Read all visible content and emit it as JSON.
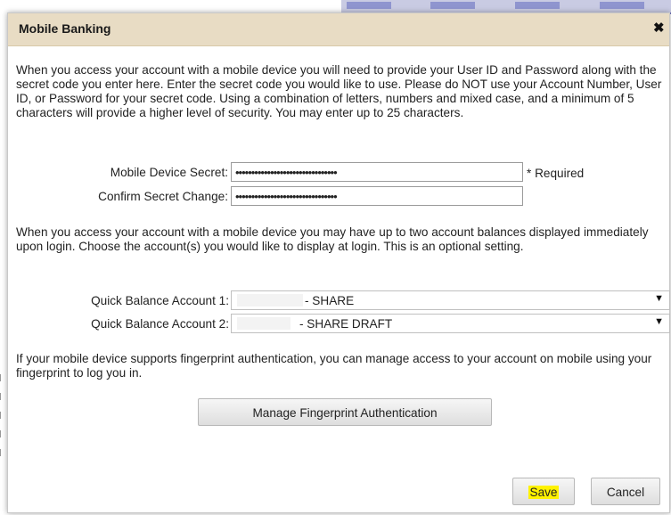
{
  "dialog": {
    "title": "Mobile Banking",
    "close_icon": "close-icon",
    "intro_text": "When you access your account with a mobile device you will need to provide your User ID and Password along with the secret code you enter here. Enter the secret code you would like to use. Please do NOT use your Account Number, User ID, or Password for your secret code. Using a combination of letters, numbers and mixed case, and a minimum of 5 characters will provide a higher level of security. You may enter up to 25 characters.",
    "secret": {
      "label": "Mobile Device Secret:",
      "value": "••••••••••••••••••••••••••••••••",
      "required_text": "* Required"
    },
    "confirm": {
      "label": "Confirm Secret Change:",
      "value": "••••••••••••••••••••••••••••••••"
    },
    "balance_text": "When you access your account with a mobile device you may have up to two account balances displayed immediately upon login. Choose the account(s) you would like to display at login. This is an optional setting.",
    "quick_balance_1": {
      "label": "Quick Balance Account 1:",
      "selected": "- SHARE"
    },
    "quick_balance_2": {
      "label": "Quick Balance Account 2:",
      "selected": "- SHARE DRAFT"
    },
    "fingerprint_text": "If your mobile device supports fingerprint authentication, you can manage access to your account on mobile using your fingerprint to log you in.",
    "fingerprint_button": "Manage Fingerprint Authentication",
    "save_button": "Save",
    "cancel_button": "Cancel"
  },
  "colors": {
    "titlebar": "#e8dcc4",
    "save_highlight": "#fff200",
    "background_nav": "#c9cbe3"
  }
}
